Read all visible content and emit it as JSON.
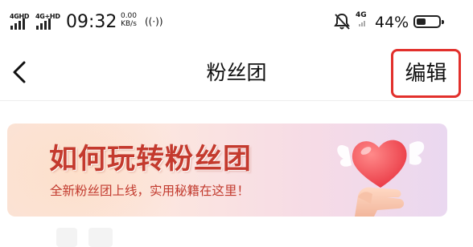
{
  "status_bar": {
    "sim1_tag": "4GHD",
    "sim2_tag": "4G+HD",
    "time": "09:32",
    "speed_value": "0.00",
    "speed_unit": "KB/s",
    "hotspot": "((·))",
    "net_type": "4G",
    "battery_percent": "44%",
    "battery_level": 0.44
  },
  "nav": {
    "back_icon": "chevron-left-icon",
    "title": "粉丝团",
    "edit_label": "编辑",
    "highlight_color": "#e2302c"
  },
  "banner": {
    "title": "如何玩转粉丝团",
    "subtitle": "全新粉丝团上线，实用秘籍在这里！",
    "title_color": "#c43a2e",
    "illustration_icon": "hand-holding-heart-icon"
  }
}
